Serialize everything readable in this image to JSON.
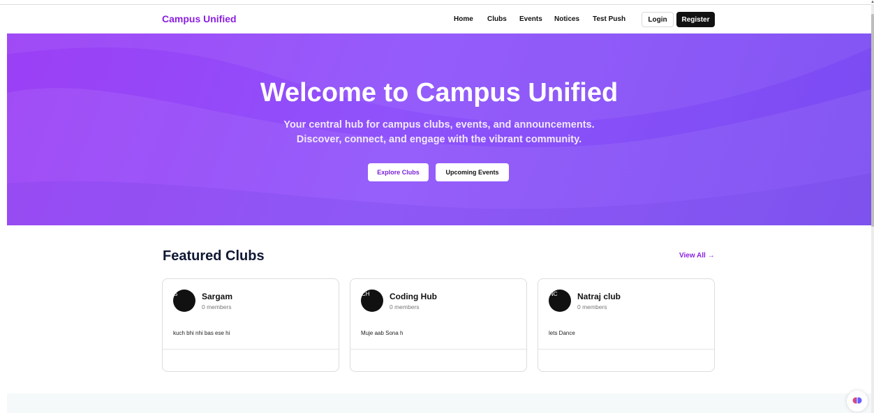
{
  "navbar": {
    "brand": "Campus Unified",
    "links": [
      "Home",
      "Clubs",
      "Events",
      "Notices",
      "Test Push"
    ],
    "login": "Login",
    "register": "Register"
  },
  "hero": {
    "title": "Welcome to Campus Unified",
    "subtitle_line1": "Your central hub for campus clubs, events, and announcements.",
    "subtitle_line2": "Discover, connect, and engage with the vibrant community.",
    "explore_button": "Explore Clubs",
    "events_button": "Upcoming Events"
  },
  "featured": {
    "title": "Featured Clubs",
    "view_all": "View All →",
    "clubs": [
      {
        "initials": "S",
        "name": "Sargam",
        "members": "0 members",
        "description": "kuch bhi nhi bas ese hi"
      },
      {
        "initials": "CH",
        "name": "Coding Hub",
        "members": "0 members",
        "description": "Muje aab Sona h"
      },
      {
        "initials": "NC",
        "name": "Natraj club",
        "members": "0 members",
        "description": "lets Dance"
      }
    ]
  },
  "colors": {
    "brand": "#8a1fe0",
    "hero_start": "#9b3ff5",
    "hero_end": "#7a4bf2",
    "dark_button": "#111111"
  },
  "icons": {
    "floating": "brain-icon"
  }
}
